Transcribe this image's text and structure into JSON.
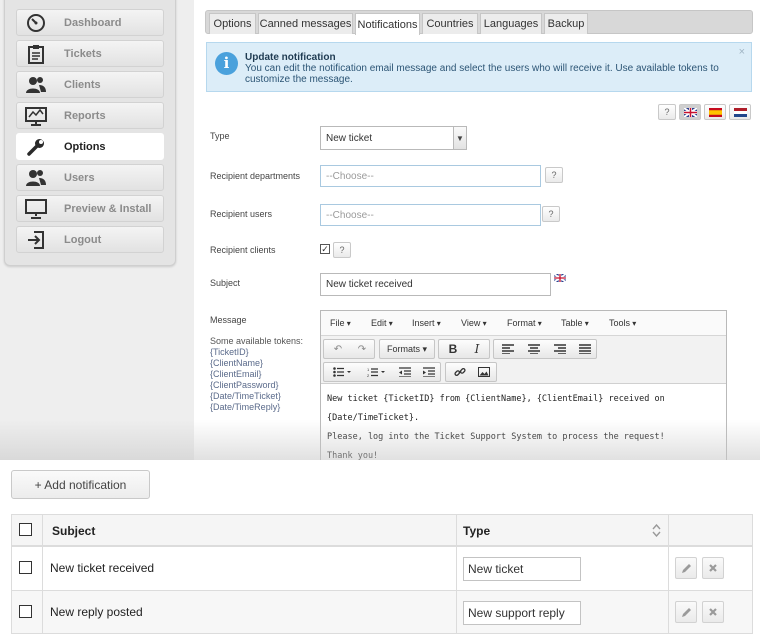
{
  "sidebar": {
    "items": [
      {
        "label": "Dashboard",
        "icon": "dashboard-icon",
        "active": false
      },
      {
        "label": "Tickets",
        "icon": "clipboard-icon",
        "active": false
      },
      {
        "label": "Clients",
        "icon": "users-icon",
        "active": false
      },
      {
        "label": "Reports",
        "icon": "chart-icon",
        "active": false
      },
      {
        "label": "Options",
        "icon": "wrench-icon",
        "active": true
      },
      {
        "label": "Users",
        "icon": "users-icon",
        "active": false
      },
      {
        "label": "Preview & Install",
        "icon": "monitor-icon",
        "active": false
      },
      {
        "label": "Logout",
        "icon": "logout-icon",
        "active": false
      }
    ]
  },
  "tabs": [
    "Options",
    "Canned messages",
    "Notifications",
    "Countries",
    "Languages",
    "Backup"
  ],
  "active_tab": "Notifications",
  "notice": {
    "title": "Update notification",
    "text": "You can edit the notification email message and select the users who will receive it. Use available tokens to customize the message.",
    "close": "×"
  },
  "help_label": "?",
  "languages": [
    "en-flag",
    "es-flag",
    "nl-flag"
  ],
  "form": {
    "type_label": "Type",
    "type_value": "New ticket",
    "departments_label": "Recipient departments",
    "departments_placeholder": "--Choose--",
    "users_label": "Recipient users",
    "users_placeholder": "--Choose--",
    "clients_label": "Recipient clients",
    "clients_checked": true,
    "subject_label": "Subject",
    "subject_value": "New ticket received",
    "message_label": "Message",
    "tokens_intro": "Some available tokens:",
    "tokens": [
      "{TicketID}",
      "{ClientName}",
      "{ClientEmail}",
      "{ClientPassword}",
      "{Date/TimeTicket}",
      "{Date/TimeReply}"
    ]
  },
  "editor": {
    "menus": [
      "File",
      "Edit",
      "Insert",
      "View",
      "Format",
      "Table",
      "Tools"
    ],
    "formats_label": "Formats",
    "bold_label": "B",
    "italic_label": "I",
    "content": [
      "New ticket {TicketID} from {ClientName}, {ClientEmail} received on {Date/TimeTicket}.",
      "Please, log into the Ticket Support System to process the request!",
      "Thank you!"
    ]
  },
  "add_button": "+ Add notification",
  "grid": {
    "headers": {
      "subject": "Subject",
      "type": "Type"
    },
    "rows": [
      {
        "subject": "New ticket received",
        "type": "New ticket"
      },
      {
        "subject": "New reply posted",
        "type": "New support reply"
      }
    ]
  },
  "colors": {
    "accent": "#4aa1dc",
    "notice_bg": "#dcedf8"
  }
}
